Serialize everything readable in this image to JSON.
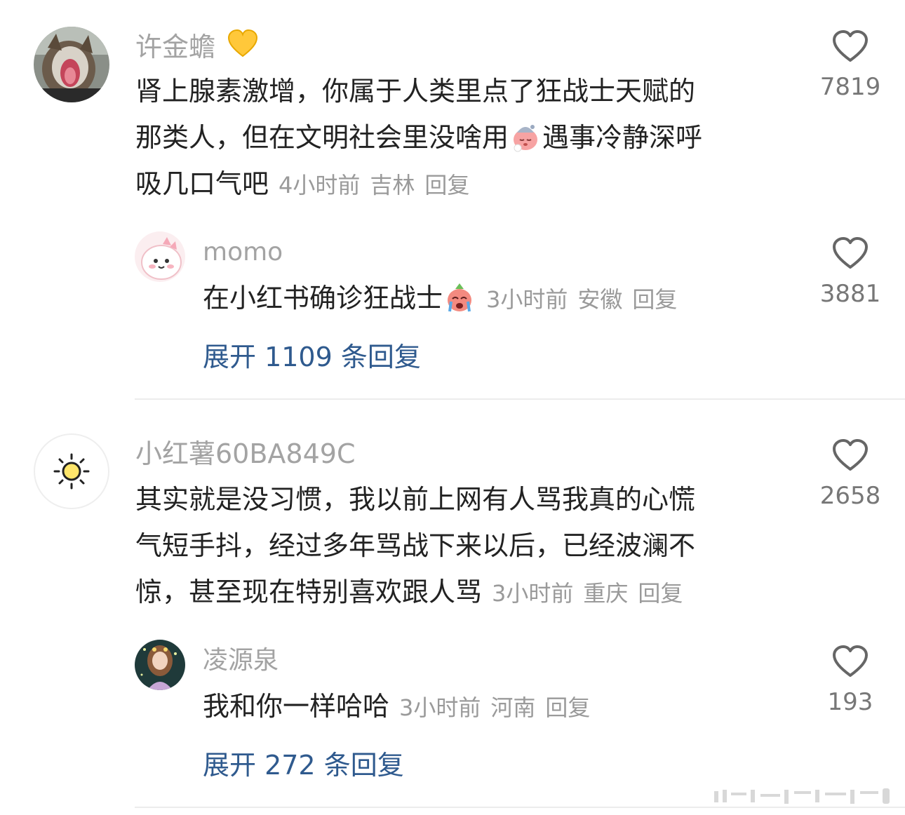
{
  "comments": [
    {
      "username": "许金蟾",
      "username_badge": "yellow-heart-emoji",
      "text_lines": [
        "肾上腺素激增，你属于人类里点了狂战士天赋的",
        "那类人，但在文明社会里没啥用",
        "遇事冷静深呼",
        "吸几口气吧"
      ],
      "time": "4小时前",
      "location": "吉林",
      "reply_label": "回复",
      "likes": "7819",
      "reply": {
        "username": "momo",
        "text": "在小红书确诊狂战士",
        "time": "3小时前",
        "location": "安徽",
        "reply_label": "回复",
        "likes": "3881"
      },
      "expand_label": "展开 1109 条回复"
    },
    {
      "username": "小红薯60BA849C",
      "text_lines": [
        "其实就是没习惯，我以前上网有人骂我真的心慌",
        "气短手抖，经过多年骂战下来以后，已经波澜不",
        "惊，甚至现在特别喜欢跟人骂"
      ],
      "time": "3小时前",
      "location": "重庆",
      "reply_label": "回复",
      "likes": "2658",
      "reply": {
        "username": "凌源泉",
        "text": "我和你一样哈哈",
        "time": "3小时前",
        "location": "河南",
        "reply_label": "回复",
        "likes": "193"
      },
      "expand_label": "展开 272 条回复"
    }
  ],
  "colors": {
    "username": "#a3a3a3",
    "meta": "#9a9a9a",
    "expand_link": "#2f5a8e",
    "text": "#222222"
  },
  "icons": [
    "heart-outline-icon",
    "sun-icon",
    "sleepy-emoji",
    "crying-emoji"
  ]
}
